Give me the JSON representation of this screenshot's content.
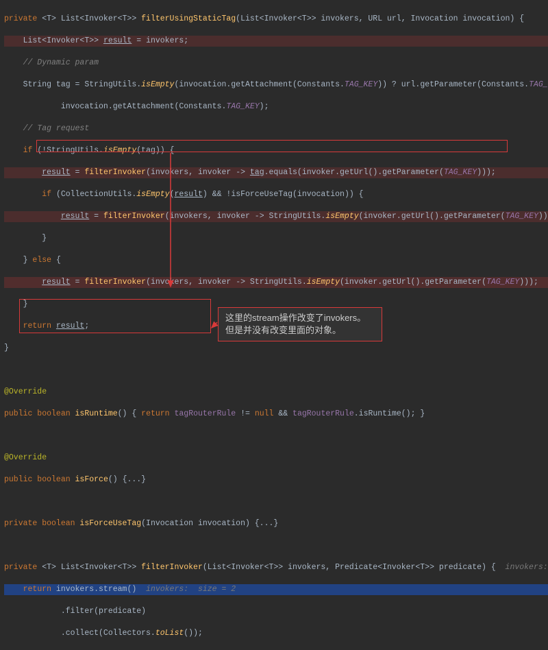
{
  "c": {
    "sig1a": "private <T> List<Invoker<T>> filterUsingStaticTag(List<Invoker<T>> invokers, URL url, Invocation invocation) {",
    "decl": "    List<Invoker<T>> result = invokers;",
    "cmt1": "    // Dynamic param",
    "l3a": "    String tag = StringUtils.isEmpty(invocation.getAttachment(Constants.TAG_KEY)) ? url.getParameter(Constants.TAG_KEY) :",
    "l3b": "            invocation.getAttachment(Constants.TAG_KEY);",
    "cmt2": "    // Tag request",
    "if1": "    if (!StringUtils.isEmpty(tag)) {",
    "r1": "        result = filterInvoker(invokers, invoker -> tag.equals(invoker.getUrl().getParameter(TAG_KEY)));",
    "if2": "        if (CollectionUtils.isEmpty(result) && !isForceUseTag(invocation)) {",
    "r2": "            result = filterInvoker(invokers, invoker -> StringUtils.isEmpty(invoker.getUrl().getParameter(TAG_KEY)));",
    "cb1": "        }",
    "else": "    } else {",
    "r3": "        result = filterInvoker(invokers, invoker -> StringUtils.isEmpty(invoker.getUrl().getParameter(TAG_KEY)));",
    "cb2": "    }",
    "ret": "    return result;",
    "cb3": "}",
    "ovr": "@Override",
    "isRun": "public boolean isRuntime() { return tagRouterRule != null && tagRouterRule.isRuntime(); }",
    "isForce": "public boolean isForce() {...}",
    "isFUT": "private boolean isForceUseTag(Invocation invocation) {...}",
    "sig2": "private <T> List<Invoker<T>> filterInvoker(List<Invoker<T>> invokers, Predicate<Invoker<T>> predicate) {",
    "hint2": "  invokers:  size",
    "retStr": "    return invokers.stream()",
    "hintsize": "  invokers:  size = 2",
    "filt": "            .filter(predicate)",
    "coll": "            .collect(Collectors.toList());",
    "annot1": "这里的stream操作改变了invokers。",
    "annot2": "但是并没有改变里面的对象。"
  }
}
